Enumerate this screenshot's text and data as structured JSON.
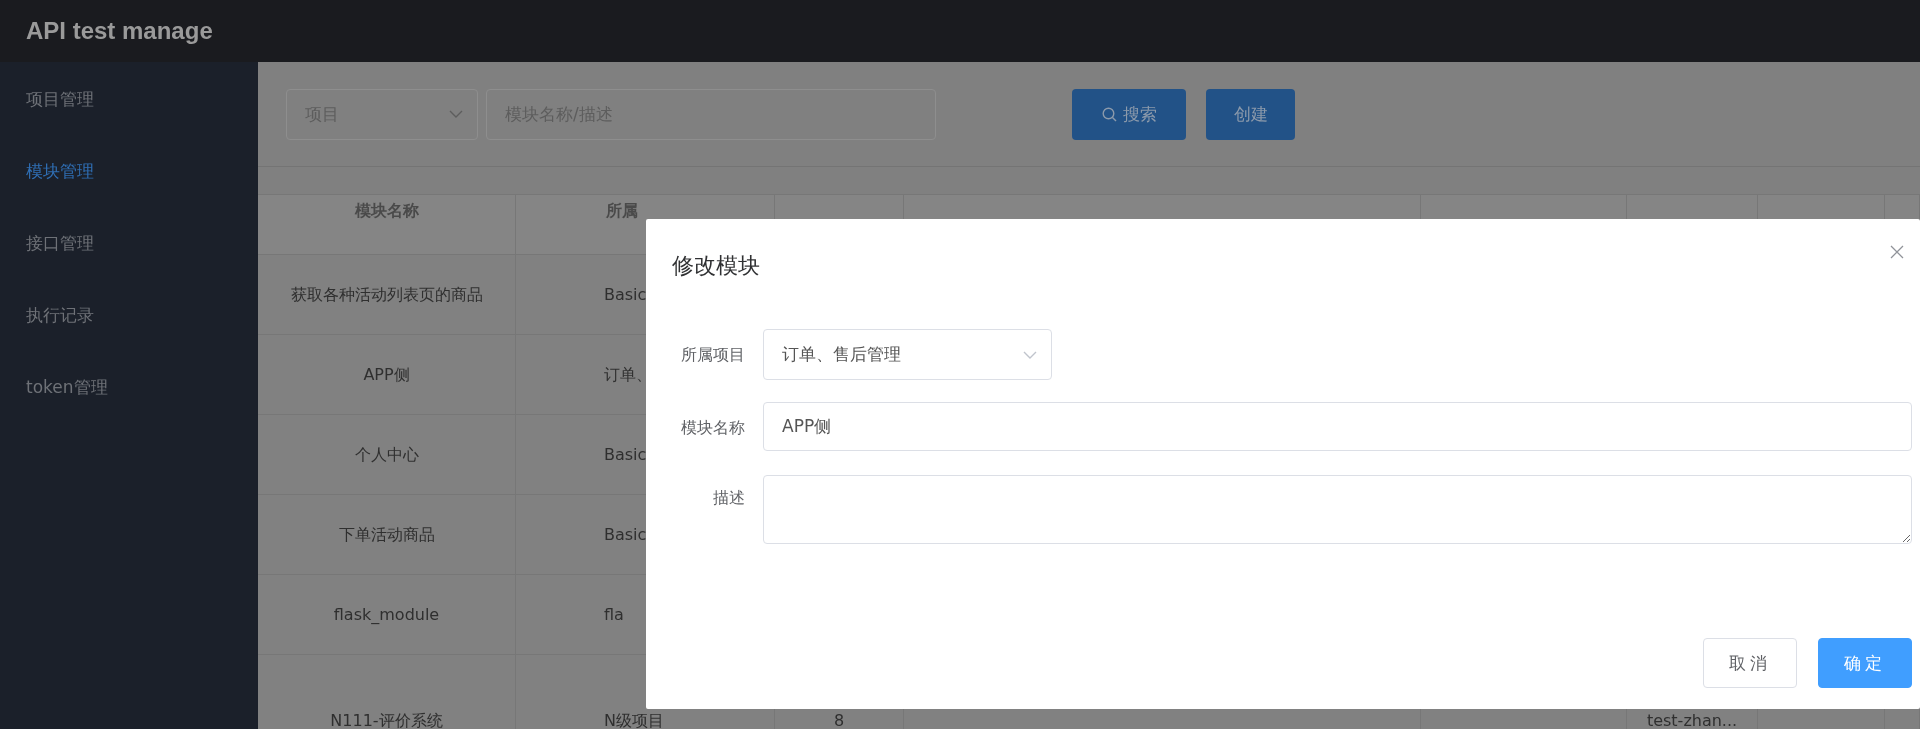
{
  "header": {
    "title": "API test manage"
  },
  "sidebar": {
    "items": [
      {
        "label": "项目管理",
        "selected": false
      },
      {
        "label": "模块管理",
        "selected": true
      },
      {
        "label": "接口管理",
        "selected": false
      },
      {
        "label": "执行记录",
        "selected": false
      },
      {
        "label": "token管理",
        "selected": false
      }
    ]
  },
  "search": {
    "project_select": {
      "placeholder": "项目"
    },
    "keyword": {
      "placeholder": "模块名称/描述"
    },
    "buttons": [
      {
        "label": "搜索",
        "kind": "search"
      },
      {
        "label": "创建",
        "kind": "create"
      }
    ]
  },
  "table": {
    "columns": [
      "模块名称",
      "所属"
    ],
    "rows": [
      {
        "module_name": "获取各种活动列表页的商品",
        "project": "Basic"
      },
      {
        "module_name": "APP侧",
        "project": "订单、"
      },
      {
        "module_name": "个人中心",
        "project": "Basic"
      },
      {
        "module_name": "下单活动商品",
        "project": "Basic"
      },
      {
        "module_name": "flask_module",
        "project": "fla"
      },
      {
        "module_name": "N111-评价系统",
        "project": "N级项目",
        "column_3": "8",
        "column_6": "test-zhan..."
      }
    ]
  },
  "modal": {
    "title": "修改模块",
    "fields": [
      {
        "label": "所属项目",
        "kind": "select",
        "value": "订单、售后管理"
      },
      {
        "label": "模块名称",
        "kind": "input",
        "value": "APP侧"
      },
      {
        "label": "描述",
        "kind": "textarea"
      }
    ],
    "buttons": [
      {
        "label": "取消",
        "kind": "default"
      },
      {
        "label": "确定",
        "kind": "primary"
      }
    ]
  }
}
